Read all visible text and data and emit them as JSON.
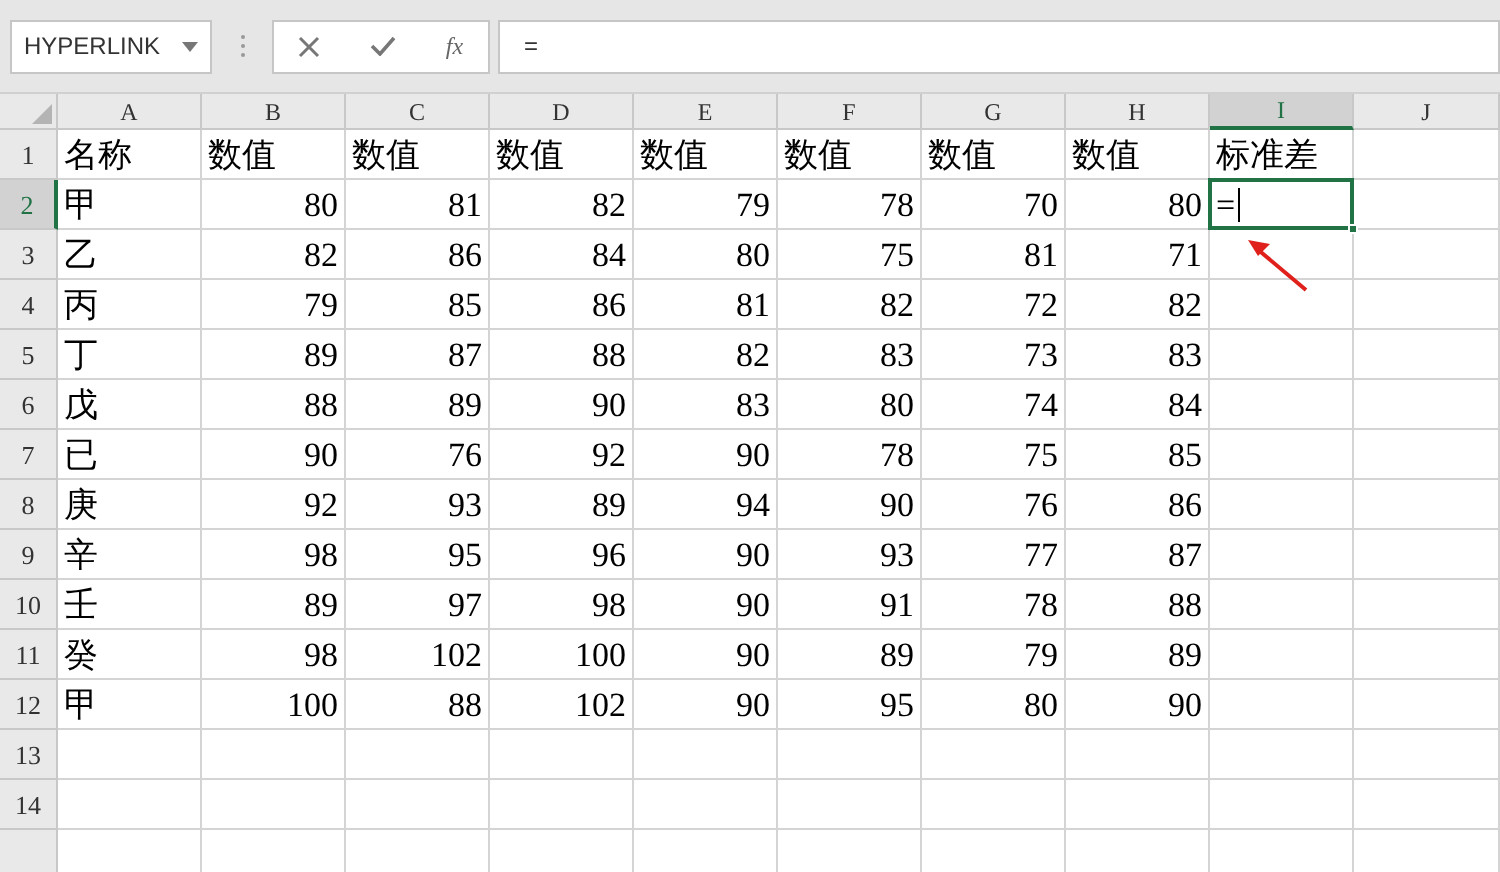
{
  "name_box": {
    "value": "HYPERLINK"
  },
  "formula_bar": {
    "function_label": "fx",
    "value": "="
  },
  "columns": [
    {
      "label": "A",
      "selected": false
    },
    {
      "label": "B",
      "selected": false
    },
    {
      "label": "C",
      "selected": false
    },
    {
      "label": "D",
      "selected": false
    },
    {
      "label": "E",
      "selected": false
    },
    {
      "label": "F",
      "selected": false
    },
    {
      "label": "G",
      "selected": false
    },
    {
      "label": "H",
      "selected": false
    },
    {
      "label": "I",
      "selected": true
    },
    {
      "label": "J",
      "selected": false
    }
  ],
  "rows": [
    {
      "label": "1",
      "selected": false,
      "kind": "header",
      "cells": [
        "名称",
        "数值",
        "数值",
        "数值",
        "数值",
        "数值",
        "数值",
        "数值",
        "标准差"
      ]
    },
    {
      "label": "2",
      "selected": true,
      "kind": "data",
      "cells": [
        "甲",
        "80",
        "81",
        "82",
        "79",
        "78",
        "70",
        "80",
        "="
      ]
    },
    {
      "label": "3",
      "selected": false,
      "kind": "data",
      "cells": [
        "乙",
        "82",
        "86",
        "84",
        "80",
        "75",
        "81",
        "71"
      ]
    },
    {
      "label": "4",
      "selected": false,
      "kind": "data",
      "cells": [
        "丙",
        "79",
        "85",
        "86",
        "81",
        "82",
        "72",
        "82"
      ]
    },
    {
      "label": "5",
      "selected": false,
      "kind": "data",
      "cells": [
        "丁",
        "89",
        "87",
        "88",
        "82",
        "83",
        "73",
        "83"
      ]
    },
    {
      "label": "6",
      "selected": false,
      "kind": "data",
      "cells": [
        "戊",
        "88",
        "89",
        "90",
        "83",
        "80",
        "74",
        "84"
      ]
    },
    {
      "label": "7",
      "selected": false,
      "kind": "data",
      "cells": [
        "已",
        "90",
        "76",
        "92",
        "90",
        "78",
        "75",
        "85"
      ]
    },
    {
      "label": "8",
      "selected": false,
      "kind": "data",
      "cells": [
        "庚",
        "92",
        "93",
        "89",
        "94",
        "90",
        "76",
        "86"
      ]
    },
    {
      "label": "9",
      "selected": false,
      "kind": "data",
      "cells": [
        "辛",
        "98",
        "95",
        "96",
        "90",
        "93",
        "77",
        "87"
      ]
    },
    {
      "label": "10",
      "selected": false,
      "kind": "data",
      "cells": [
        "壬",
        "89",
        "97",
        "98",
        "90",
        "91",
        "78",
        "88"
      ]
    },
    {
      "label": "11",
      "selected": false,
      "kind": "data",
      "cells": [
        "癸",
        "98",
        "102",
        "100",
        "90",
        "89",
        "79",
        "89"
      ]
    },
    {
      "label": "12",
      "selected": false,
      "kind": "data",
      "cells": [
        "甲",
        "100",
        "88",
        "102",
        "90",
        "95",
        "80",
        "90"
      ]
    },
    {
      "label": "13",
      "selected": false,
      "kind": "empty"
    },
    {
      "label": "14",
      "selected": false,
      "kind": "empty"
    }
  ]
}
